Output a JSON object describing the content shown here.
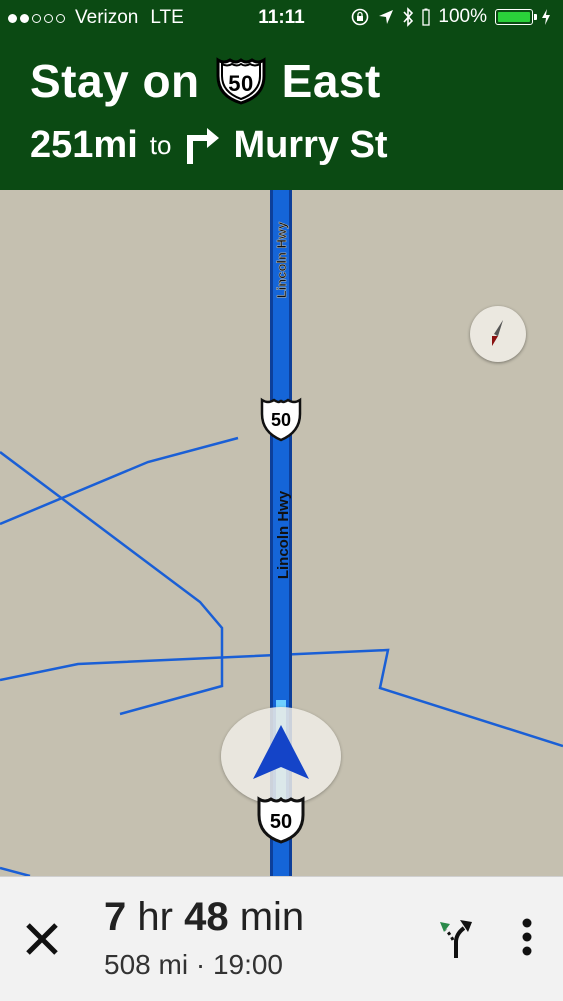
{
  "status_bar": {
    "carrier": "Verizon",
    "network": "LTE",
    "time": "11:11",
    "battery": "100%",
    "signal_dots_filled": 2,
    "signal_dots_total": 5
  },
  "navigation": {
    "instruction_prefix": "Stay on",
    "route_shield": "50",
    "instruction_direction": "East",
    "distance": "251mi",
    "distance_connector": "to",
    "next_street": "Murry St"
  },
  "map": {
    "road_name_upper": "Lincoln Hwy",
    "road_name_middle": "Lincoln Hwy",
    "shield_upper": "50",
    "shield_lower": "50"
  },
  "trip": {
    "hours": "7",
    "hours_unit": "hr",
    "minutes": "48",
    "minutes_unit": "min",
    "distance": "508 mi",
    "separator": "·",
    "arrival": "19:00"
  },
  "colors": {
    "header_green": "#0b4a13",
    "map_background": "#c5c0b0",
    "route_blue": "#1565d8",
    "route_blue_light": "#63a9ff",
    "minor_road": "#1a5fd6",
    "location_arrow": "#1444c8"
  },
  "icons": [
    "signal-dots-icon",
    "rotation-lock-icon",
    "location-arrow-icon",
    "bluetooth-icon",
    "battery-icon",
    "charging-icon",
    "us-route-shield-icon",
    "turn-right-icon",
    "compass-icon",
    "location-puck-icon",
    "close-icon",
    "alternate-routes-icon",
    "more-vert-icon"
  ]
}
